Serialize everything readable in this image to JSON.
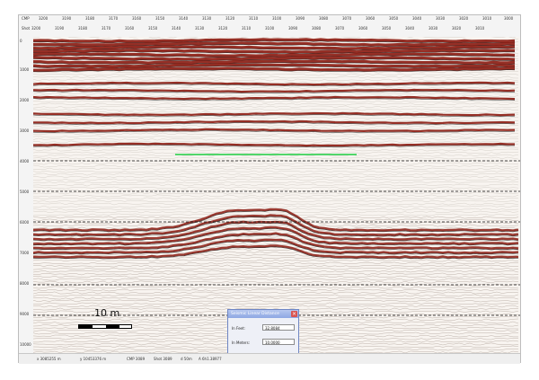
{
  "ruler": {
    "cmp_label": "CMP",
    "shot_label": "Shot",
    "cmp_ticks": [
      "3200",
      "3190",
      "3180",
      "3170",
      "3160",
      "3150",
      "3140",
      "3130",
      "3120",
      "3110",
      "3100",
      "3090",
      "3080",
      "3070",
      "3060",
      "3050",
      "3040",
      "3030",
      "3020",
      "3010",
      "3000"
    ],
    "shot_ticks": [
      "3200",
      "3190",
      "3180",
      "3170",
      "3160",
      "3150",
      "3140",
      "3130",
      "3120",
      "3110",
      "3100",
      "3090",
      "3080",
      "3070",
      "3060",
      "3050",
      "3040",
      "3030",
      "3020",
      "3010"
    ],
    "depth_ticks": [
      "0",
      "1000",
      "2000",
      "3000",
      "4000",
      "5000",
      "6000",
      "7000",
      "8000",
      "9000",
      "10000"
    ]
  },
  "scale_bar": {
    "label": "10 m"
  },
  "dialog": {
    "title": "Seismic Linear Distance",
    "feet_label": "In Feet:",
    "feet_value": "32.8084",
    "meters_label": "In Meters:",
    "meters_value": "10.0000"
  },
  "status": {
    "x": "x 3085255 m",
    "y": "y 10453376 m",
    "cmp": "CMP 3089",
    "shot": "Shot 3089",
    "d": "d 50m",
    "a": "A 6h1.38977"
  },
  "colors": {
    "reflector": "#8b1a10",
    "measure_line": "#52d66b",
    "dialog_border": "#6f86c4"
  }
}
